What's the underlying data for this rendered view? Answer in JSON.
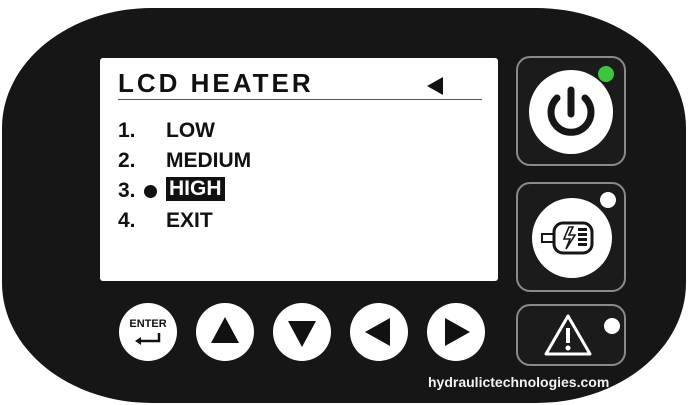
{
  "screen": {
    "title": "LCD HEATER",
    "menu": [
      {
        "number": "1.",
        "label": "LOW",
        "selected": false
      },
      {
        "number": "2.",
        "label": "MEDIUM",
        "selected": false
      },
      {
        "number": "3.",
        "label": "HIGH",
        "selected": true
      },
      {
        "number": "4.",
        "label": "EXIT",
        "selected": false
      }
    ]
  },
  "buttons": {
    "enter_label": "ENTER",
    "power_icon": "power-icon",
    "heater_icon": "heater-icon",
    "warning_icon": "warning-icon"
  },
  "indicators": {
    "power_led_color": "#3ec43e",
    "heater_led_color": "#ffffff",
    "warning_led_color": "#ffffff"
  },
  "colors": {
    "panel": "#161616",
    "screen": "#ffffff",
    "button_border": "#8a8a8a"
  },
  "footer": {
    "website": "hydraulictechnologies.com"
  }
}
